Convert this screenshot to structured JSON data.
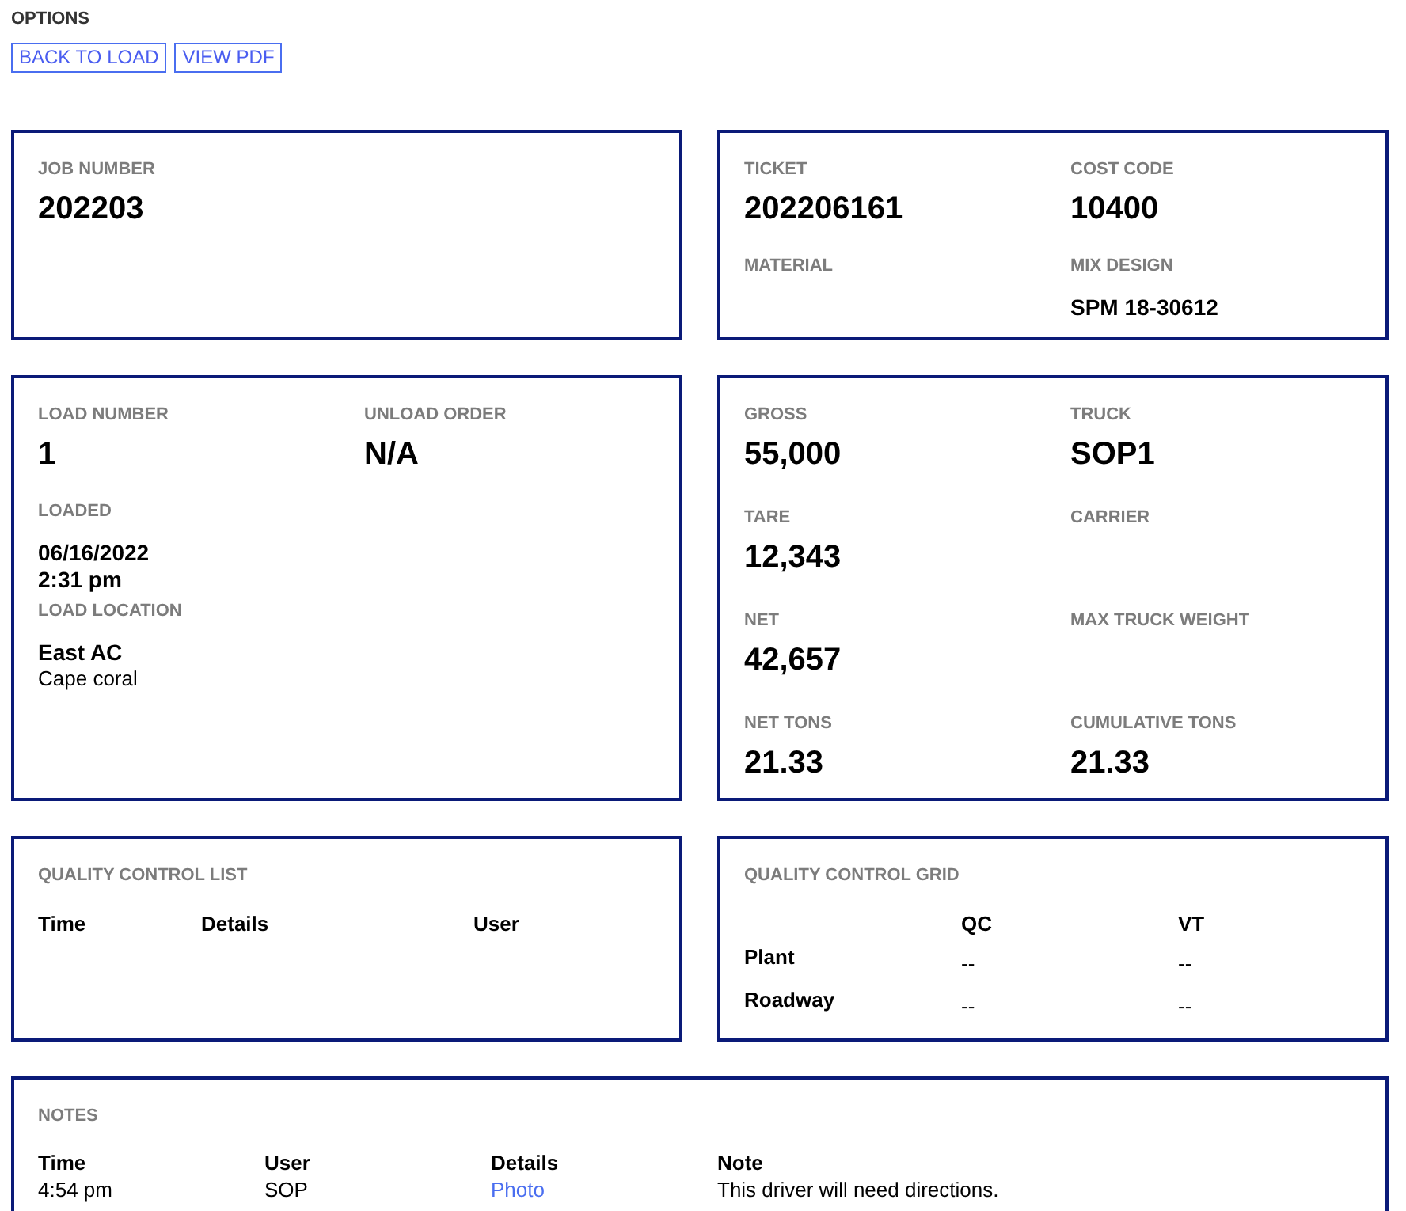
{
  "options": {
    "title": "OPTIONS",
    "buttons": [
      "BACK TO LOAD",
      "VIEW PDF"
    ]
  },
  "cards": [
    {
      "rows": [
        [
          {
            "label": "JOB NUMBER",
            "values": [
              {
                "text": "202203",
                "kind": "large"
              }
            ]
          }
        ]
      ]
    },
    {
      "rows": [
        [
          {
            "label": "TICKET",
            "values": [
              {
                "text": "202206161",
                "kind": "large"
              }
            ]
          },
          {
            "label": "COST CODE",
            "values": [
              {
                "text": "10400",
                "kind": "large"
              }
            ]
          }
        ],
        [
          {
            "label": "MATERIAL"
          },
          {
            "label": "MIX DESIGN",
            "values": [
              {
                "text": "SPM 18-30612",
                "kind": "medium"
              }
            ]
          }
        ]
      ]
    },
    {
      "rows": [
        [
          {
            "label": "LOAD NUMBER",
            "values": [
              {
                "text": "1",
                "kind": "large"
              }
            ]
          },
          {
            "label": "UNLOAD ORDER",
            "values": [
              {
                "text": "N/A",
                "kind": "large"
              }
            ]
          }
        ],
        [
          {
            "label": "LOADED",
            "values": [
              {
                "text": "06/16/2022",
                "kind": "medium"
              },
              {
                "text": "2:31 pm",
                "kind": "medium"
              }
            ]
          }
        ],
        [
          {
            "label": "LOAD LOCATION",
            "values": [
              {
                "text": "East AC",
                "kind": "medium"
              },
              {
                "text": "Cape coral",
                "kind": "small"
              }
            ]
          }
        ]
      ]
    },
    {
      "rows": [
        [
          {
            "label": "GROSS",
            "values": [
              {
                "text": "55,000",
                "kind": "large"
              }
            ]
          },
          {
            "label": "TRUCK",
            "values": [
              {
                "text": "SOP1",
                "kind": "large"
              }
            ]
          }
        ],
        [
          {
            "label": "TARE",
            "values": [
              {
                "text": "12,343",
                "kind": "large"
              }
            ]
          },
          {
            "label": "CARRIER"
          }
        ],
        [
          {
            "label": "NET",
            "values": [
              {
                "text": "42,657",
                "kind": "large"
              }
            ]
          },
          {
            "label": "MAX TRUCK WEIGHT"
          }
        ],
        [
          {
            "label": "NET TONS",
            "values": [
              {
                "text": "21.33",
                "kind": "large"
              }
            ]
          },
          {
            "label": "CUMULATIVE TONS",
            "values": [
              {
                "text": "21.33",
                "kind": "large"
              }
            ]
          }
        ]
      ]
    }
  ],
  "qc_list": {
    "title": "QUALITY CONTROL LIST",
    "columns": [
      "Time",
      "Details",
      "User"
    ]
  },
  "qc_grid": {
    "title": "QUALITY CONTROL GRID",
    "columns": [
      "QC",
      "VT"
    ],
    "rows": [
      {
        "label": "Plant",
        "cells": [
          "--",
          "--"
        ]
      },
      {
        "label": "Roadway",
        "cells": [
          "--",
          "--"
        ]
      }
    ]
  },
  "notes": {
    "title": "NOTES",
    "columns": [
      "Time",
      "User",
      "Details",
      "Note"
    ],
    "rows": [
      {
        "cells": [
          {
            "text": "4:54 pm",
            "kind": "text"
          },
          {
            "text": "SOP",
            "kind": "text"
          },
          {
            "text": "Photo",
            "kind": "link"
          },
          {
            "text": "This driver will need directions.",
            "kind": "text"
          }
        ]
      }
    ]
  }
}
